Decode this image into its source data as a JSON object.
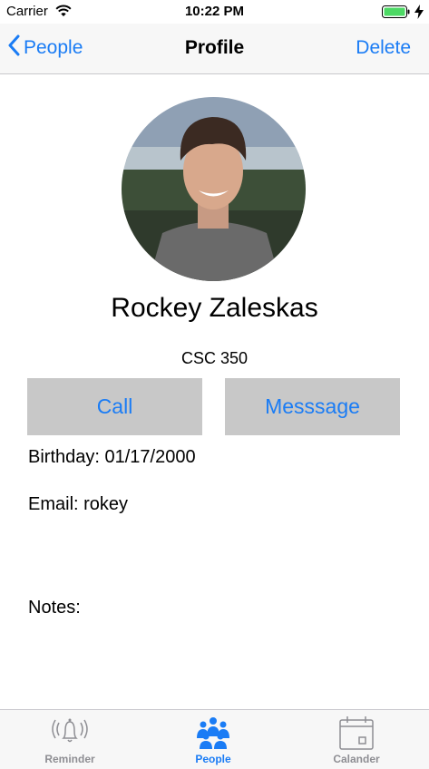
{
  "status": {
    "carrier": "Carrier",
    "time": "10:22 PM"
  },
  "nav": {
    "back_label": "People",
    "title": "Profile",
    "action_label": "Delete"
  },
  "profile": {
    "name": "Rockey Zaleskas",
    "course": "CSC 350",
    "birthday": "Birthday: 01/17/2000",
    "email": "Email: rokey",
    "notes": "Notes:"
  },
  "buttons": {
    "call": "Call",
    "message": "Messsage"
  },
  "tabs": [
    {
      "label": "Reminder",
      "icon": "bell-icon",
      "active": false
    },
    {
      "label": "People",
      "icon": "people-icon",
      "active": true
    },
    {
      "label": "Calander",
      "icon": "calendar-icon",
      "active": false
    }
  ],
  "colors": {
    "accent": "#1a7cf5",
    "button_bg": "#c8c8c8",
    "battery": "#4cd964"
  }
}
